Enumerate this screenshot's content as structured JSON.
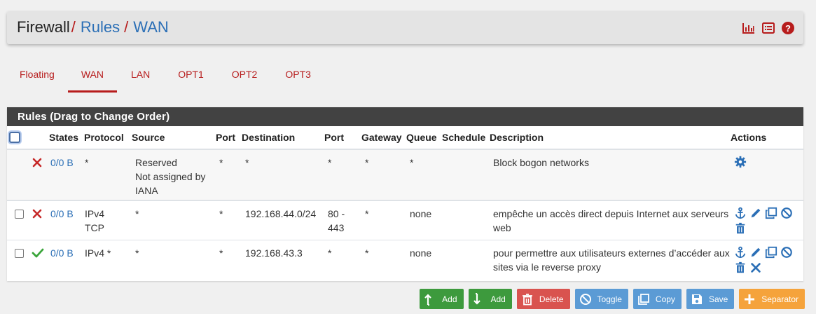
{
  "breadcrumb": {
    "root": "Firewall",
    "separator": "/",
    "level1": "Rules",
    "level2": "WAN"
  },
  "header_icons": [
    "bar-chart-icon",
    "list-icon",
    "help-icon"
  ],
  "tabs": [
    {
      "label": "Floating",
      "active": false
    },
    {
      "label": "WAN",
      "active": true
    },
    {
      "label": "LAN",
      "active": false
    },
    {
      "label": "OPT1",
      "active": false
    },
    {
      "label": "OPT2",
      "active": false
    },
    {
      "label": "OPT3",
      "active": false
    }
  ],
  "panel": {
    "title": "Rules (Drag to Change Order)"
  },
  "columns": [
    "",
    "",
    "States",
    "Protocol",
    "Source",
    "Port",
    "Destination",
    "Port",
    "Gateway",
    "Queue",
    "Schedule",
    "Description",
    "Actions"
  ],
  "rows": [
    {
      "status": "block",
      "states": "0/0 B",
      "protocol": "*",
      "source": "Reserved\nNot assigned by IANA",
      "source_port": "*",
      "destination": "*",
      "destination_port": "*",
      "gateway": "*",
      "queue": "*",
      "schedule": "",
      "description": "Block bogon networks",
      "actions": [
        "gear-icon"
      ]
    },
    {
      "status": "block",
      "states": "0/0 B",
      "protocol": "IPv4\nTCP",
      "source": "*",
      "source_port": "*",
      "destination": "192.168.44.0/24",
      "destination_port": "80 -\n443",
      "gateway": "*",
      "queue": "none",
      "schedule": "",
      "description": "empêche un accès direct depuis Internet aux serveurs web",
      "actions": [
        "anchor-icon",
        "pencil-icon",
        "copy-icon",
        "disable-icon",
        "trash-icon"
      ]
    },
    {
      "status": "pass",
      "states": "0/0 B",
      "protocol": "IPv4 *",
      "source": "*",
      "source_port": "*",
      "destination": "192.168.43.3",
      "destination_port": "*",
      "gateway": "*",
      "queue": "none",
      "schedule": "",
      "description": "pour permettre aux utilisateurs externes d’accéder aux sites via le reverse proxy",
      "actions": [
        "anchor-icon",
        "pencil-icon",
        "copy-icon",
        "disable-icon",
        "trash-icon",
        "delete-x-icon"
      ]
    }
  ],
  "buttons": [
    {
      "label": "Add",
      "icon": "arrow-up-icon",
      "color": "#3d9a3d"
    },
    {
      "label": "Add",
      "icon": "arrow-down-icon",
      "color": "#3d9a3d"
    },
    {
      "label": "Delete",
      "icon": "trash-icon",
      "color": "#d9534f"
    },
    {
      "label": "Toggle",
      "icon": "ban-icon",
      "color": "#5b9bd5"
    },
    {
      "label": "Copy",
      "icon": "copy-icon",
      "color": "#5b9bd5"
    },
    {
      "label": "Save",
      "icon": "save-icon",
      "color": "#5b9bd5"
    },
    {
      "label": "Separator",
      "icon": "plus-icon",
      "color": "#f5a33b"
    }
  ],
  "colors": {
    "accent_red": "#b71c1c",
    "link_blue": "#2b6fb6",
    "pass_green": "#3aa53a",
    "panel_header": "#424242"
  }
}
